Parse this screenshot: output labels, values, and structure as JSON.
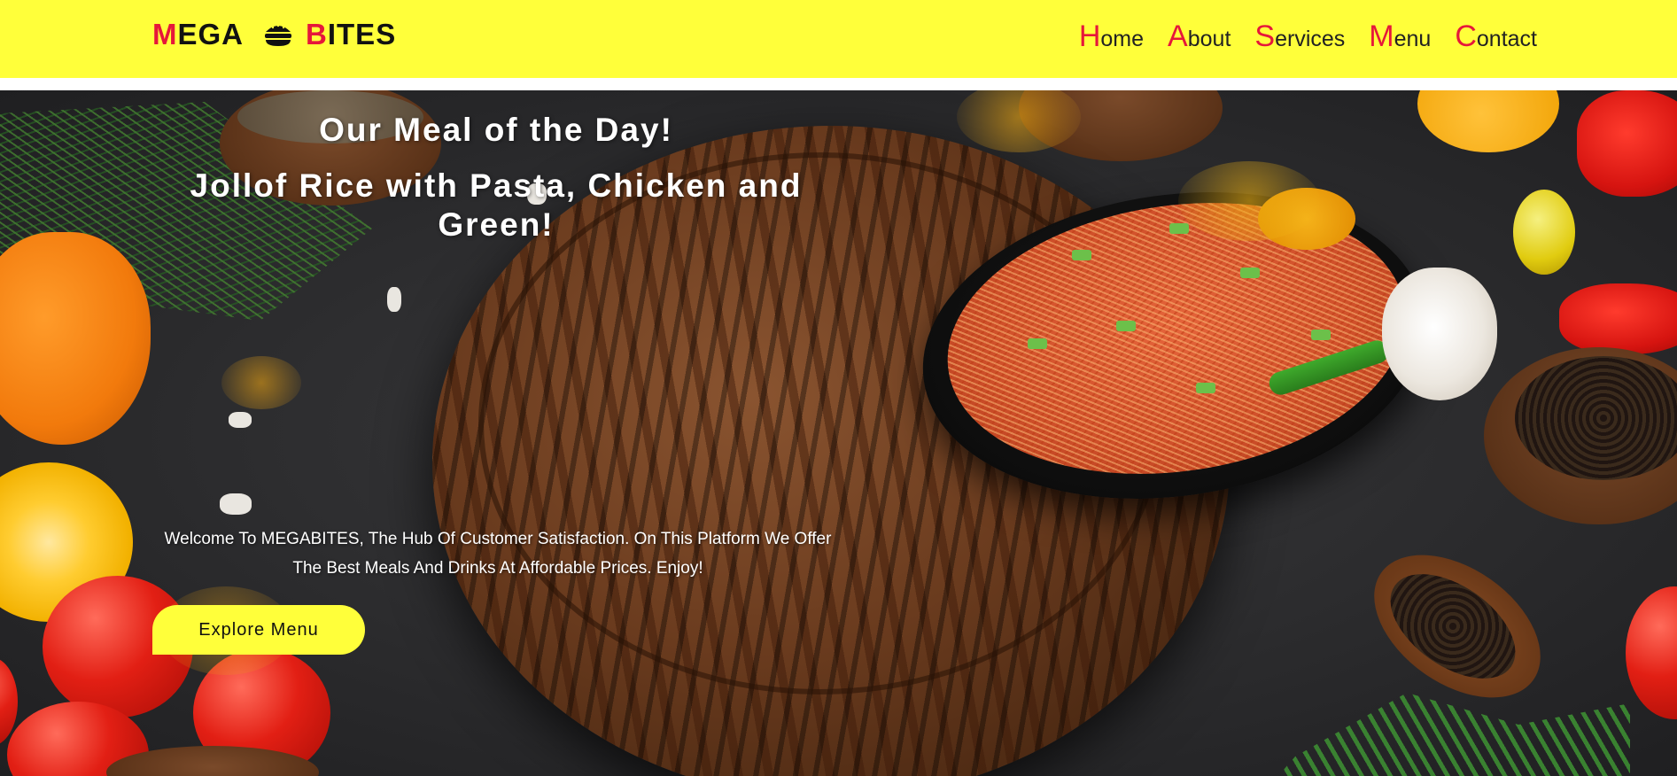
{
  "header": {
    "logo": {
      "part1_first": "M",
      "part1_rest": "EGA",
      "part2_first": "B",
      "part2_rest": "ITES"
    },
    "nav": [
      {
        "first": "H",
        "rest": "ome"
      },
      {
        "first": "A",
        "rest": "bout"
      },
      {
        "first": "S",
        "rest": "ervices"
      },
      {
        "first": "M",
        "rest": "enu"
      },
      {
        "first": "C",
        "rest": "ontact"
      }
    ]
  },
  "hero": {
    "title": "Our Meal of the Day!",
    "subtitle": "Jollof Rice with Pasta, Chicken and Green!",
    "welcome_line1": "Welcome To MEGABITES, The Hub Of Customer Satisfaction. On This Platform We Offer",
    "welcome_line2": "The Best Meals And Drinks At Affordable Prices. Enjoy!",
    "cta_label": "Explore Menu"
  },
  "colors": {
    "header_bg": "#ffff3a",
    "accent": "#e6173a",
    "cta_bg": "#ffff3a"
  }
}
